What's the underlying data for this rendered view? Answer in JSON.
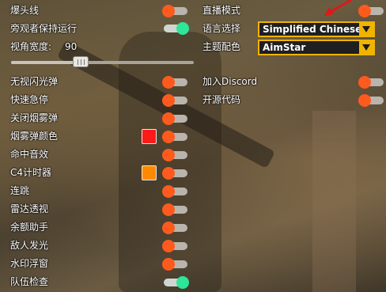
{
  "left_options": [
    {
      "label": "爆头线",
      "state": "off"
    },
    {
      "label": "旁观者保持运行",
      "state": "on"
    },
    {
      "label": "无视闪光弹",
      "state": "off"
    },
    {
      "label": "快速急停",
      "state": "off"
    },
    {
      "label": "关闭烟雾弹",
      "state": "off"
    },
    {
      "label": "烟雾弹颜色",
      "state": "off",
      "swatch": "#ff1a1a"
    },
    {
      "label": "命中音效",
      "state": "off"
    },
    {
      "label": "C4计时器",
      "state": "off",
      "swatch": "#ff8a00"
    },
    {
      "label": "连跳",
      "state": "off"
    },
    {
      "label": "雷达透视",
      "state": "off"
    },
    {
      "label": "余额助手",
      "state": "off"
    },
    {
      "label": "敌人发光",
      "state": "off"
    },
    {
      "label": "水印浮窗",
      "state": "off"
    },
    {
      "label": "队伍检查",
      "state": "on"
    }
  ],
  "fov": {
    "label": "视角宽度:",
    "value_text": "90",
    "fraction": 0.37
  },
  "right_options": {
    "stream_mode_label": "直播模式",
    "language_label": "语言选择",
    "language_value": "Simplified Chinese",
    "theme_label": "主题配色",
    "theme_value": "AimStar",
    "discord_label": "加入Discord",
    "opensource_label": "开源代码"
  },
  "colors": {
    "toggle_off_knob": "#ff5a1e",
    "toggle_on_knob": "#2ee59a",
    "select_border": "#f0b400"
  }
}
